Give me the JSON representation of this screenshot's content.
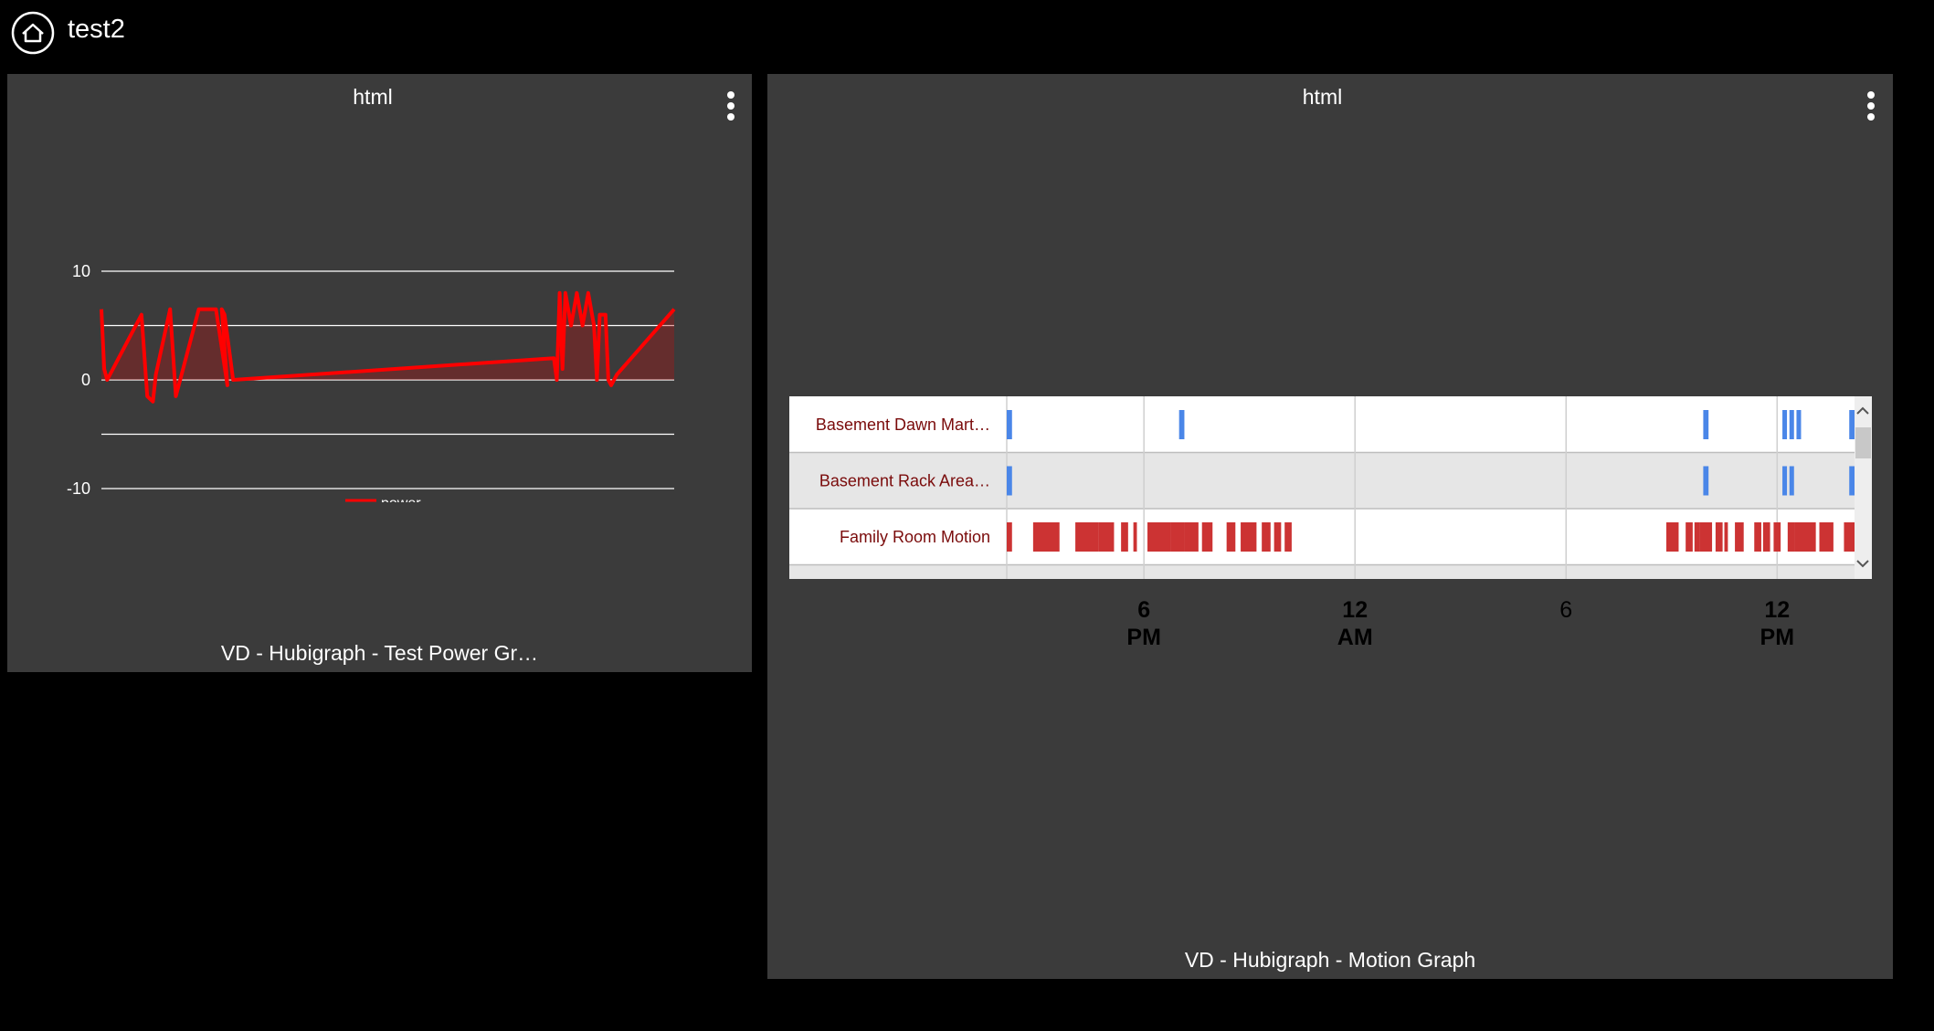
{
  "header": {
    "title": "test2",
    "home_icon": "home-icon"
  },
  "tiles": [
    {
      "title": "html",
      "footer": "VD - Hubigraph - Test Power Gr…",
      "menu_icon": "more-vertical-icon"
    },
    {
      "title": "html",
      "footer": "VD - Hubigraph - Motion Graph",
      "menu_icon": "more-vertical-icon"
    }
  ],
  "chart_data": [
    {
      "type": "area",
      "title": "",
      "xlabel": "",
      "ylabel": "",
      "ylim": [
        -10,
        10
      ],
      "yticks": [
        10,
        0,
        -10
      ],
      "grid": true,
      "legend": {
        "position": "bottom",
        "entries": [
          "power"
        ]
      },
      "series": [
        {
          "name": "power",
          "color": "#ff0000",
          "x": [
            0,
            0.5,
            1,
            4,
            7,
            8,
            9,
            9.5,
            12,
            13,
            17,
            20,
            22,
            21,
            21.5,
            23,
            79,
            79.5,
            80,
            80.5,
            81,
            82,
            83,
            84,
            85,
            86,
            86.5,
            87,
            88,
            88.5,
            89,
            90,
            100
          ],
          "y": [
            6.5,
            1,
            0,
            3,
            6,
            -1.5,
            -2,
            0.5,
            6.5,
            -1.5,
            6.5,
            6.5,
            -0.5,
            6.5,
            6,
            0,
            2,
            0,
            8,
            1,
            8,
            5,
            8,
            5,
            8,
            5,
            0,
            6,
            6,
            0,
            -0.5,
            0.5,
            6.5
          ]
        }
      ]
    },
    {
      "type": "timeline",
      "rows": [
        "Basement Dawn Mart…",
        "Basement Rack Area…",
        "Family Room Motion"
      ],
      "x_ticks": [
        {
          "top": "6",
          "bottom": "PM"
        },
        {
          "top": "12",
          "bottom": "AM"
        },
        {
          "top": "6",
          "bottom": ""
        },
        {
          "top": "12",
          "bottom": "PM"
        }
      ],
      "x_tick_hours": [
        6,
        12,
        18,
        24
      ],
      "x_range_hours": [
        2.1,
        26.2
      ],
      "row_colors": [
        "#4a86e8",
        "#4a86e8",
        "#cc3333"
      ],
      "events": [
        [
          [
            2.1,
            2.25
          ],
          [
            7.0,
            7.15
          ],
          [
            21.9,
            22.05
          ],
          [
            24.15,
            24.28
          ],
          [
            24.35,
            24.48
          ],
          [
            24.55,
            24.68
          ],
          [
            26.05,
            26.2
          ]
        ],
        [
          [
            2.1,
            2.25
          ],
          [
            21.9,
            22.05
          ],
          [
            24.15,
            24.28
          ],
          [
            24.35,
            24.48
          ],
          [
            26.05,
            26.2
          ]
        ],
        [
          [
            2.1,
            2.25
          ],
          [
            2.85,
            3.6
          ],
          [
            4.05,
            4.7
          ],
          [
            4.7,
            5.15
          ],
          [
            5.35,
            5.55
          ],
          [
            5.7,
            5.8
          ],
          [
            6.1,
            6.75
          ],
          [
            6.75,
            7.15
          ],
          [
            7.15,
            7.55
          ],
          [
            7.65,
            7.95
          ],
          [
            8.35,
            8.6
          ],
          [
            8.75,
            9.2
          ],
          [
            9.35,
            9.6
          ],
          [
            9.7,
            9.9
          ],
          [
            10.0,
            10.2
          ],
          [
            20.85,
            21.2
          ],
          [
            21.4,
            21.6
          ],
          [
            21.65,
            21.8
          ],
          [
            21.8,
            22.15
          ],
          [
            22.25,
            22.45
          ],
          [
            22.5,
            22.6
          ],
          [
            22.8,
            23.05
          ],
          [
            23.35,
            23.55
          ],
          [
            23.6,
            23.8
          ],
          [
            23.9,
            24.1
          ],
          [
            24.3,
            24.5
          ],
          [
            24.5,
            25.1
          ],
          [
            25.2,
            25.6
          ],
          [
            25.9,
            26.2
          ]
        ]
      ]
    }
  ]
}
